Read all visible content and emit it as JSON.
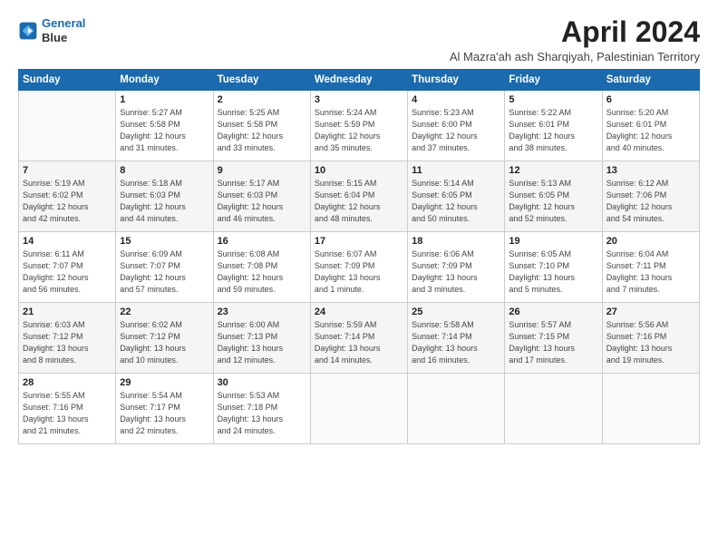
{
  "logo": {
    "line1": "General",
    "line2": "Blue"
  },
  "title": "April 2024",
  "subtitle": "Al Mazra'ah ash Sharqiyah, Palestinian Territory",
  "days_header": [
    "Sunday",
    "Monday",
    "Tuesday",
    "Wednesday",
    "Thursday",
    "Friday",
    "Saturday"
  ],
  "weeks": [
    [
      {
        "day": "",
        "info": ""
      },
      {
        "day": "1",
        "info": "Sunrise: 5:27 AM\nSunset: 5:58 PM\nDaylight: 12 hours\nand 31 minutes."
      },
      {
        "day": "2",
        "info": "Sunrise: 5:25 AM\nSunset: 5:58 PM\nDaylight: 12 hours\nand 33 minutes."
      },
      {
        "day": "3",
        "info": "Sunrise: 5:24 AM\nSunset: 5:59 PM\nDaylight: 12 hours\nand 35 minutes."
      },
      {
        "day": "4",
        "info": "Sunrise: 5:23 AM\nSunset: 6:00 PM\nDaylight: 12 hours\nand 37 minutes."
      },
      {
        "day": "5",
        "info": "Sunrise: 5:22 AM\nSunset: 6:01 PM\nDaylight: 12 hours\nand 38 minutes."
      },
      {
        "day": "6",
        "info": "Sunrise: 5:20 AM\nSunset: 6:01 PM\nDaylight: 12 hours\nand 40 minutes."
      }
    ],
    [
      {
        "day": "7",
        "info": "Sunrise: 5:19 AM\nSunset: 6:02 PM\nDaylight: 12 hours\nand 42 minutes."
      },
      {
        "day": "8",
        "info": "Sunrise: 5:18 AM\nSunset: 6:03 PM\nDaylight: 12 hours\nand 44 minutes."
      },
      {
        "day": "9",
        "info": "Sunrise: 5:17 AM\nSunset: 6:03 PM\nDaylight: 12 hours\nand 46 minutes."
      },
      {
        "day": "10",
        "info": "Sunrise: 5:15 AM\nSunset: 6:04 PM\nDaylight: 12 hours\nand 48 minutes."
      },
      {
        "day": "11",
        "info": "Sunrise: 5:14 AM\nSunset: 6:05 PM\nDaylight: 12 hours\nand 50 minutes."
      },
      {
        "day": "12",
        "info": "Sunrise: 5:13 AM\nSunset: 6:05 PM\nDaylight: 12 hours\nand 52 minutes."
      },
      {
        "day": "13",
        "info": "Sunrise: 6:12 AM\nSunset: 7:06 PM\nDaylight: 12 hours\nand 54 minutes."
      }
    ],
    [
      {
        "day": "14",
        "info": "Sunrise: 6:11 AM\nSunset: 7:07 PM\nDaylight: 12 hours\nand 56 minutes."
      },
      {
        "day": "15",
        "info": "Sunrise: 6:09 AM\nSunset: 7:07 PM\nDaylight: 12 hours\nand 57 minutes."
      },
      {
        "day": "16",
        "info": "Sunrise: 6:08 AM\nSunset: 7:08 PM\nDaylight: 12 hours\nand 59 minutes."
      },
      {
        "day": "17",
        "info": "Sunrise: 6:07 AM\nSunset: 7:09 PM\nDaylight: 13 hours\nand 1 minute."
      },
      {
        "day": "18",
        "info": "Sunrise: 6:06 AM\nSunset: 7:09 PM\nDaylight: 13 hours\nand 3 minutes."
      },
      {
        "day": "19",
        "info": "Sunrise: 6:05 AM\nSunset: 7:10 PM\nDaylight: 13 hours\nand 5 minutes."
      },
      {
        "day": "20",
        "info": "Sunrise: 6:04 AM\nSunset: 7:11 PM\nDaylight: 13 hours\nand 7 minutes."
      }
    ],
    [
      {
        "day": "21",
        "info": "Sunrise: 6:03 AM\nSunset: 7:12 PM\nDaylight: 13 hours\nand 8 minutes."
      },
      {
        "day": "22",
        "info": "Sunrise: 6:02 AM\nSunset: 7:12 PM\nDaylight: 13 hours\nand 10 minutes."
      },
      {
        "day": "23",
        "info": "Sunrise: 6:00 AM\nSunset: 7:13 PM\nDaylight: 13 hours\nand 12 minutes."
      },
      {
        "day": "24",
        "info": "Sunrise: 5:59 AM\nSunset: 7:14 PM\nDaylight: 13 hours\nand 14 minutes."
      },
      {
        "day": "25",
        "info": "Sunrise: 5:58 AM\nSunset: 7:14 PM\nDaylight: 13 hours\nand 16 minutes."
      },
      {
        "day": "26",
        "info": "Sunrise: 5:57 AM\nSunset: 7:15 PM\nDaylight: 13 hours\nand 17 minutes."
      },
      {
        "day": "27",
        "info": "Sunrise: 5:56 AM\nSunset: 7:16 PM\nDaylight: 13 hours\nand 19 minutes."
      }
    ],
    [
      {
        "day": "28",
        "info": "Sunrise: 5:55 AM\nSunset: 7:16 PM\nDaylight: 13 hours\nand 21 minutes."
      },
      {
        "day": "29",
        "info": "Sunrise: 5:54 AM\nSunset: 7:17 PM\nDaylight: 13 hours\nand 22 minutes."
      },
      {
        "day": "30",
        "info": "Sunrise: 5:53 AM\nSunset: 7:18 PM\nDaylight: 13 hours\nand 24 minutes."
      },
      {
        "day": "",
        "info": ""
      },
      {
        "day": "",
        "info": ""
      },
      {
        "day": "",
        "info": ""
      },
      {
        "day": "",
        "info": ""
      }
    ]
  ]
}
